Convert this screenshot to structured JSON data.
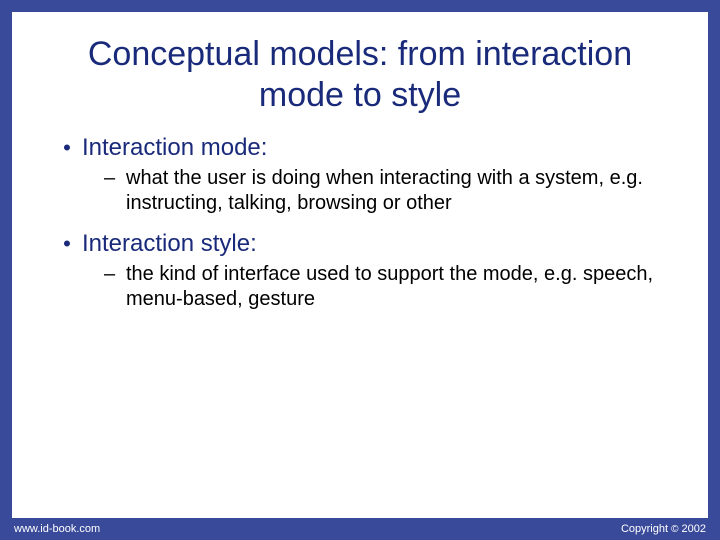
{
  "title": "Conceptual models: from interaction mode to style",
  "bullets": [
    {
      "label": "Interaction mode:",
      "sub": "what the user is doing when interacting with a system, e.g. instructing, talking, browsing or other"
    },
    {
      "label": "Interaction style:",
      "sub": "the kind of interface used to support the mode, e.g. speech, menu-based, gesture"
    }
  ],
  "footer": {
    "left": "www.id-book.com",
    "right_prefix": "Copyright ",
    "right_year": " 2002"
  }
}
